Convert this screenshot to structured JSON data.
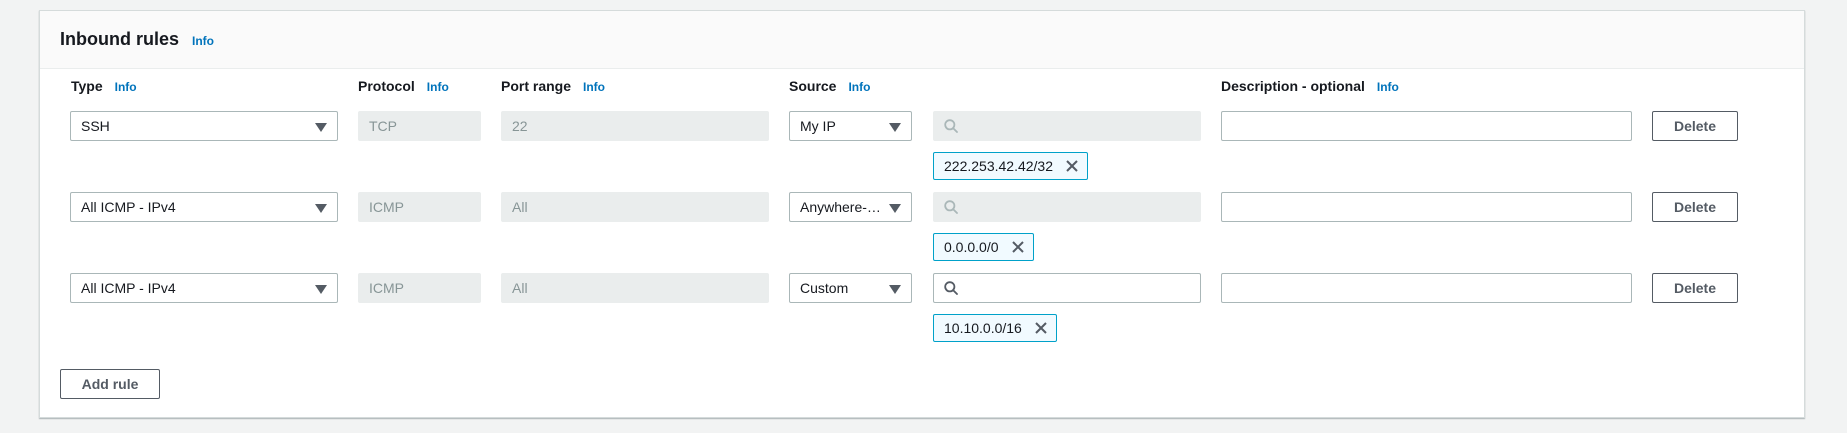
{
  "panel": {
    "title": "Inbound rules",
    "title_info": "Info"
  },
  "columns": {
    "type": {
      "label": "Type",
      "info": "Info"
    },
    "protocol": {
      "label": "Protocol",
      "info": "Info"
    },
    "port_range": {
      "label": "Port range",
      "info": "Info"
    },
    "source": {
      "label": "Source",
      "info": "Info"
    },
    "description": {
      "label": "Description - optional",
      "info": "Info"
    }
  },
  "rules": [
    {
      "type": "SSH",
      "protocol": "TCP",
      "port_range": "22",
      "source": "My IP",
      "source_search_value": "",
      "source_token": "222.253.42.42/32",
      "description": "",
      "delete_label": "Delete"
    },
    {
      "type": "All ICMP - IPv4",
      "protocol": "ICMP",
      "port_range": "All",
      "source": "Anywhere-…",
      "source_search_value": "",
      "source_token": "0.0.0.0/0",
      "description": "",
      "delete_label": "Delete"
    },
    {
      "type": "All ICMP - IPv4",
      "protocol": "ICMP",
      "port_range": "All",
      "source": "Custom",
      "source_search_value": "",
      "source_token": "10.10.0.0/16",
      "description": "",
      "delete_label": "Delete"
    }
  ],
  "add_rule_label": "Add rule",
  "icons": {
    "dropdown": "caret-down-icon",
    "search": "search-icon",
    "remove": "close-icon"
  },
  "colors": {
    "link": "#0073bb",
    "token_border": "#00a1c9",
    "token_bg": "#f1faff",
    "disabled_bg": "#eaeded"
  }
}
